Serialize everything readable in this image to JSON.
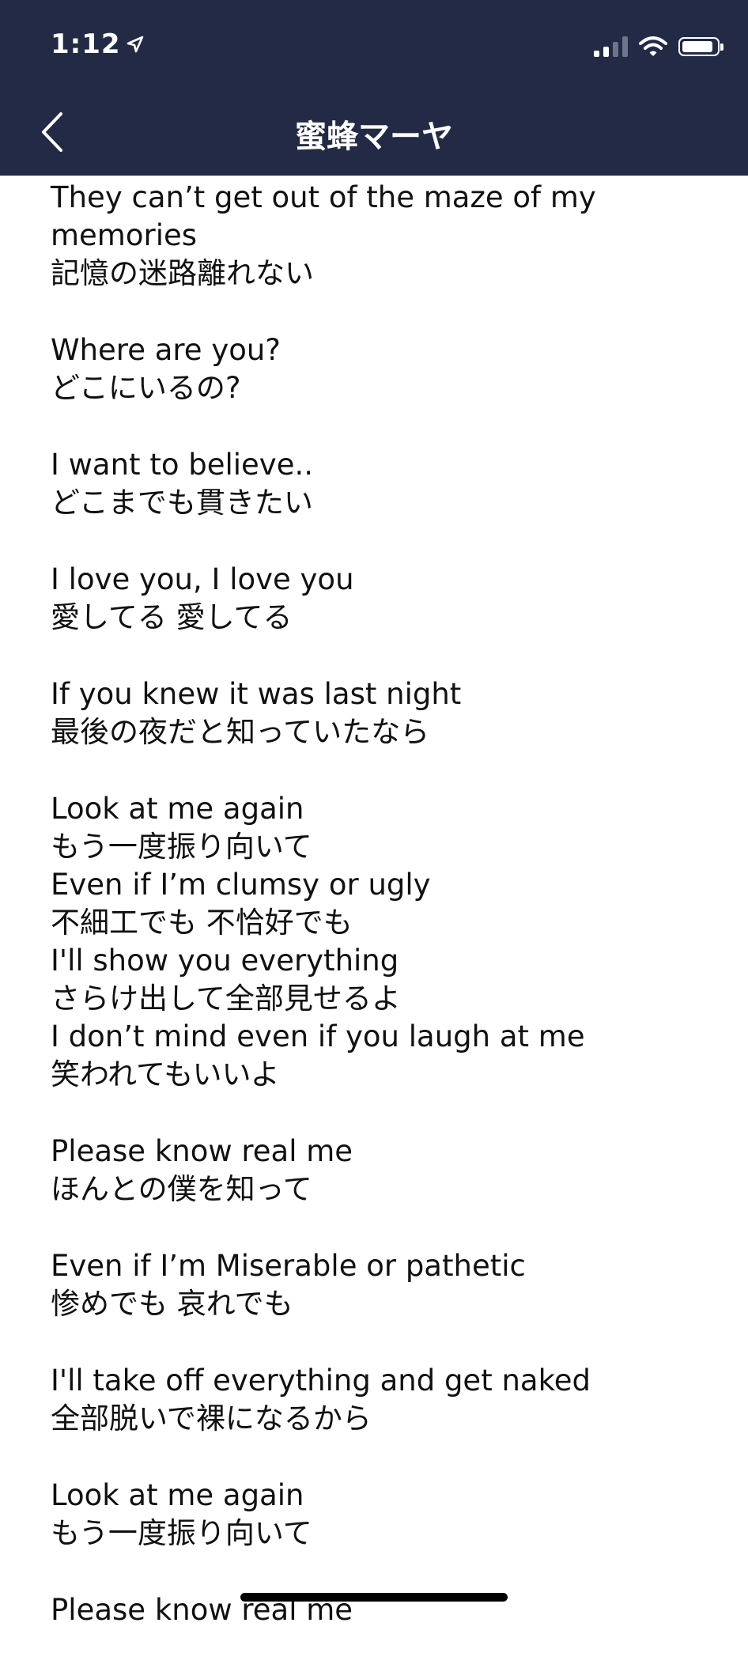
{
  "status_bar": {
    "time": "1:12"
  },
  "nav": {
    "title": "蜜蜂マーヤ"
  },
  "stanzas": [
    [
      "They can’t get out of the maze of my",
      "memories",
      "記憶の迷路離れない"
    ],
    [
      "Where are you?",
      "どこにいるの?"
    ],
    [
      "I want to believe..",
      "どこまでも貫きたい"
    ],
    [
      "I love you, I love you",
      "愛してる 愛してる"
    ],
    [
      "If you knew it was last night",
      "最後の夜だと知っていたなら"
    ],
    [
      "Look at me again",
      "もう一度振り向いて",
      "Even if I’m clumsy or ugly",
      "不細工でも 不恰好でも",
      "I'll show you everything",
      "さらけ出して全部見せるよ",
      "I don’t mind even if you laugh at me",
      "笑われてもいいよ"
    ],
    [
      "Please know real me",
      "ほんとの僕を知って"
    ],
    [
      "Even if I’m Miserable or pathetic",
      "惨めでも 哀れでも"
    ],
    [
      "I'll take off everything and get naked",
      "全部脱いで裸になるから"
    ],
    [
      "Look at me again",
      "もう一度振り向いて"
    ],
    [
      "Please know real me"
    ]
  ]
}
